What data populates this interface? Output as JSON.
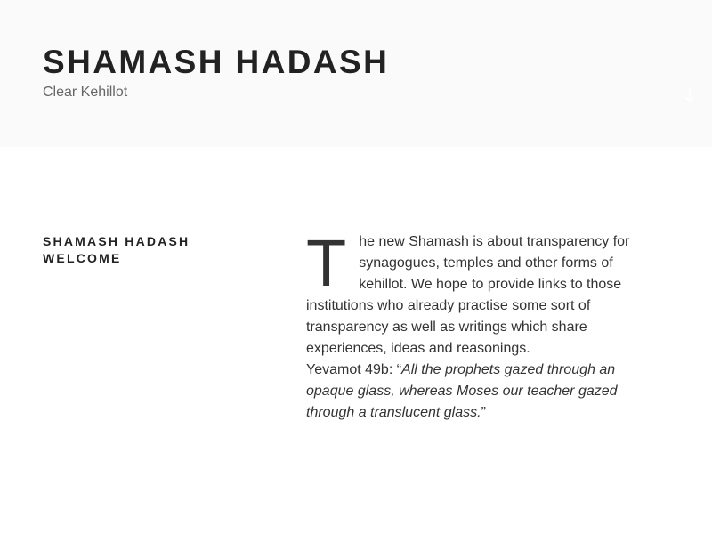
{
  "header": {
    "site_title": "SHAMASH HADASH",
    "tagline": "Clear Kehillot",
    "scroll_icon": "arrow-down-icon"
  },
  "post": {
    "title": "SHAMASH HADASH WELCOME",
    "dropcap": "T",
    "intro": "he new Shamash is about transparency for synagogues, temples and other forms of kehillot. We hope to provide links to those institutions who already practise some sort of transparency as well as writings which share experiences, ideas and reasonings.",
    "citation_prefix": "Yevamot 49b: “",
    "citation_quote": "All the prophets gazed through an opaque glass, whereas Moses our teacher gazed through a translucent glass.",
    "citation_suffix": "”"
  },
  "colors": {
    "header_bg": "#fafafa",
    "title": "#222222",
    "tagline": "#666666",
    "body_text": "#333333"
  }
}
